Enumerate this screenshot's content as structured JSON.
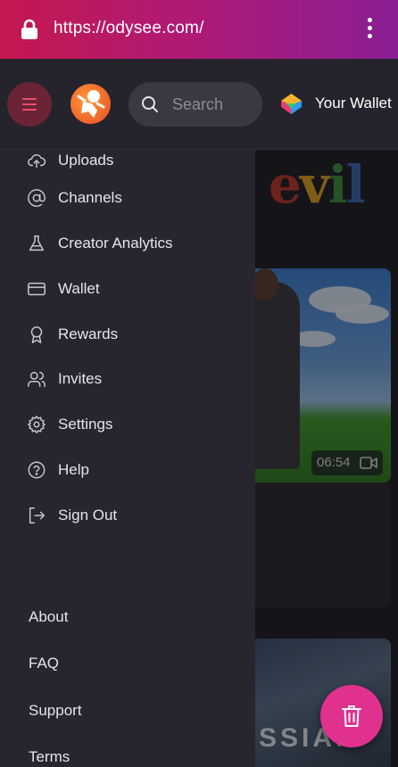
{
  "browser": {
    "url": "https://odysee.com/"
  },
  "header": {
    "search": {
      "placeholder": "Search"
    },
    "wallet": {
      "label": "Your Wallet"
    }
  },
  "drawer": {
    "items": [
      {
        "label": "Uploads",
        "icon": "cloud-upload-icon"
      },
      {
        "label": "Channels",
        "icon": "at-sign-icon"
      },
      {
        "label": "Creator Analytics",
        "icon": "flask-icon"
      },
      {
        "label": "Wallet",
        "icon": "credit-card-icon"
      },
      {
        "label": "Rewards",
        "icon": "award-icon"
      },
      {
        "label": "Invites",
        "icon": "users-icon"
      },
      {
        "label": "Settings",
        "icon": "gear-icon"
      },
      {
        "label": "Help",
        "icon": "help-circle-icon"
      },
      {
        "label": "Sign Out",
        "icon": "sign-out-icon"
      }
    ],
    "footer": [
      "About",
      "FAQ",
      "Support",
      "Terms"
    ]
  },
  "feed": {
    "banner_text": {
      "e": "e",
      "v": "v",
      "i": "i",
      "l": "l"
    },
    "video_duration": "06:54",
    "thumb2_text": "SSIAN"
  },
  "colors": {
    "accent": "#e0318f",
    "urlbar_start": "#c4184f",
    "urlbar_end": "#8a1f95",
    "drawer_bg": "#27252e"
  }
}
